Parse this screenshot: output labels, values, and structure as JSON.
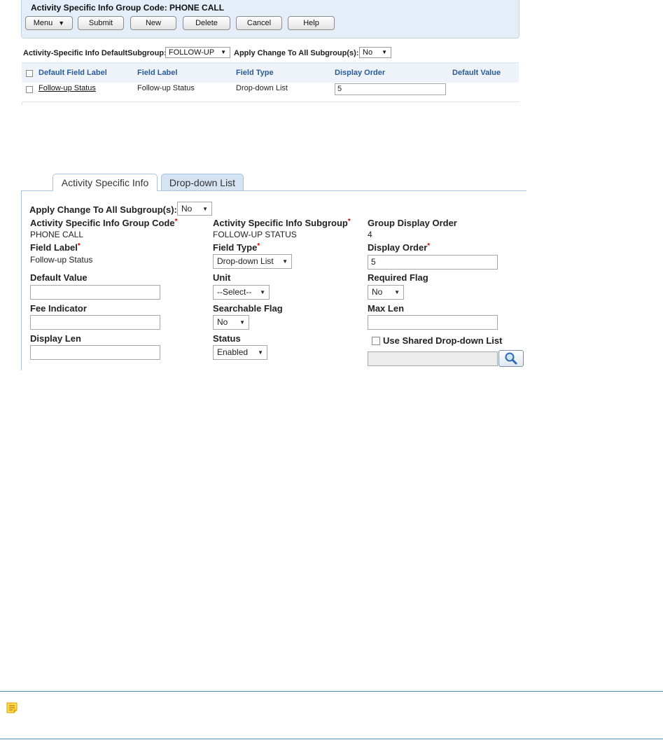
{
  "header": {
    "group_title": "Activity Specific Info Group Code: PHONE CALL",
    "buttons": {
      "menu": "Menu",
      "submit": "Submit",
      "new": "New",
      "delete": "Delete",
      "cancel": "Cancel",
      "help": "Help"
    }
  },
  "subgroup_bar": {
    "default_subgroup_label": "Activity-Specific Info DefaultSubgroup:",
    "default_subgroup_value": "FOLLOW-UP",
    "apply_change_label": "Apply Change To All Subgroup(s):",
    "apply_change_value": "No"
  },
  "grid": {
    "columns": [
      "Default Field Label",
      "Field Label",
      "Field Type",
      "Display Order",
      "Default Value"
    ],
    "rows": [
      {
        "default_field_label": "Follow-up Status",
        "field_label": "Follow-up Status",
        "field_type": "Drop-down List",
        "display_order": "5",
        "default_value": ""
      }
    ]
  },
  "tabs": {
    "active": "Activity Specific Info",
    "other": "Drop-down List"
  },
  "form": {
    "apply_change_label": "Apply Change To All Subgroup(s):",
    "apply_change_value": "No",
    "group_code_label": "Activity Specific Info Group Code",
    "group_code_value": "PHONE CALL",
    "subgroup_label": "Activity Specific Info Subgroup",
    "subgroup_value": "FOLLOW-UP STATUS",
    "group_display_order_label": "Group Display Order",
    "group_display_order_value": "4",
    "field_label_label": "Field Label",
    "field_label_value": "Follow-up Status",
    "field_type_label": "Field Type",
    "field_type_value": "Drop-down List",
    "display_order_label": "Display Order",
    "display_order_value": "5",
    "default_value_label": "Default Value",
    "default_value_value": "",
    "unit_label": "Unit",
    "unit_value": "--Select--",
    "required_flag_label": "Required Flag",
    "required_flag_value": "No",
    "fee_indicator_label": "Fee Indicator",
    "fee_indicator_value": "",
    "searchable_flag_label": "Searchable Flag",
    "searchable_flag_value": "No",
    "max_len_label": "Max Len",
    "max_len_value": "",
    "display_len_label": "Display Len",
    "display_len_value": "",
    "status_label": "Status",
    "status_value": "Enabled",
    "use_shared_label": "Use Shared Drop-down List",
    "shared_list_value": "",
    "required_marker": "*"
  },
  "icons": {
    "menu_caret": "double-chevron-down-icon",
    "dropdown": "triangle-down-icon",
    "lookup": "magnifier-icon",
    "note": "note-icon"
  },
  "colors": {
    "header_bg": "#e4eef9",
    "grid_header_text": "#2a5b9a",
    "required": "#cc0000",
    "note_border": "#4a8fc0",
    "note_icon": "#f2b400"
  }
}
